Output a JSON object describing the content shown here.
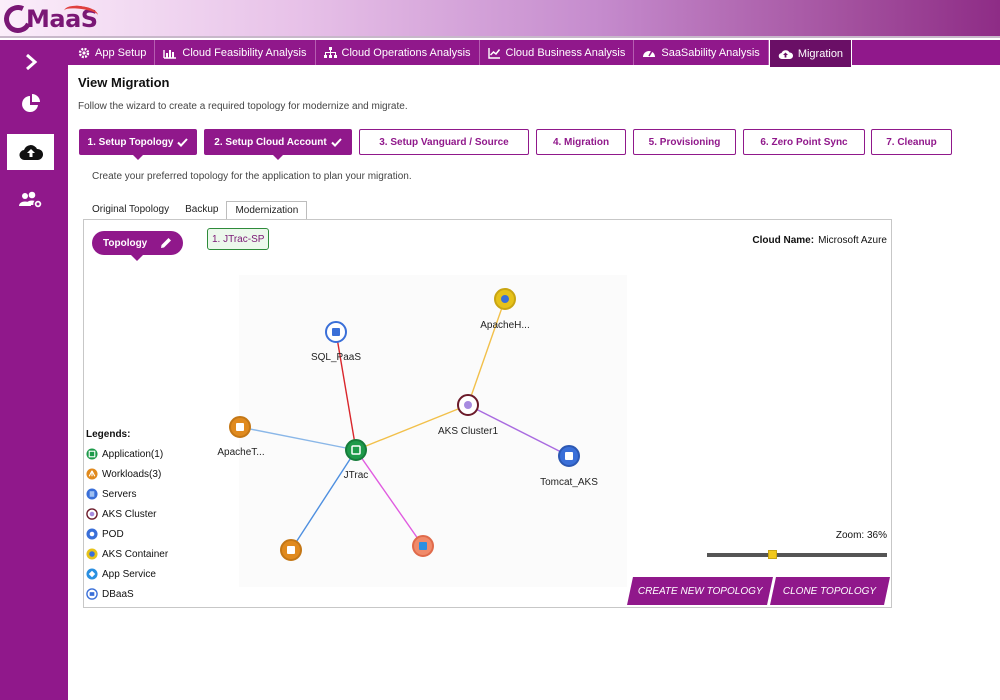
{
  "header": {
    "logo_text": "MaaS"
  },
  "sidebar": {
    "items": [
      {
        "name": "expand",
        "icon": "chevron-right-icon"
      },
      {
        "name": "dashboard",
        "icon": "pie-chart-icon"
      },
      {
        "name": "migration",
        "icon": "cloud-upload-icon"
      },
      {
        "name": "settings",
        "icon": "users-gear-icon"
      }
    ]
  },
  "tabs": [
    {
      "label": "App Setup",
      "icon": "gear-icon"
    },
    {
      "label": "Cloud Feasibility Analysis",
      "icon": "bar-chart-icon"
    },
    {
      "label": "Cloud Operations Analysis",
      "icon": "sitemap-icon"
    },
    {
      "label": "Cloud Business Analysis",
      "icon": "line-chart-icon"
    },
    {
      "label": "SaaSability Analysis",
      "icon": "gauge-icon"
    },
    {
      "label": "Migration",
      "icon": "cloud-upload-icon",
      "active": true
    }
  ],
  "page": {
    "title": "View Migration",
    "subtitle": "Follow the wizard to create a required topology for modernize and migrate.",
    "hint": "Create your preferred topology for the application to plan your migration."
  },
  "steps": [
    {
      "label": "1. Setup Topology",
      "done": true
    },
    {
      "label": "2. Setup Cloud Account",
      "done": true
    },
    {
      "label": "3. Setup Vanguard / Source",
      "done": false
    },
    {
      "label": "4. Migration",
      "done": false
    },
    {
      "label": "5. Provisioning",
      "done": false
    },
    {
      "label": "6. Zero Point Sync",
      "done": false
    },
    {
      "label": "7. Cleanup",
      "done": false
    }
  ],
  "subtabs": [
    {
      "label": "Original Topology"
    },
    {
      "label": "Backup"
    },
    {
      "label": "Modernization",
      "active": true
    }
  ],
  "panel": {
    "topology_button": "Topology",
    "chip": "1. JTrac-SP",
    "cloud_name_label": "Cloud Name:",
    "cloud_name_value": "Microsoft Azure",
    "zoom_label": "Zoom: 36%",
    "zoom_percent": 36,
    "create_button": "CREATE NEW TOPOLOGY",
    "clone_button": "CLONE TOPOLOGY"
  },
  "legend": {
    "title": "Legends:",
    "items": [
      {
        "label": "Application(1)",
        "color": "#1e9a4a"
      },
      {
        "label": "Workloads(3)",
        "color": "#e08a1e"
      },
      {
        "label": "Servers",
        "color": "#3a6fd8"
      },
      {
        "label": "AKS Cluster",
        "color": "#6b1a2a"
      },
      {
        "label": "POD",
        "color": "#3a6fd8"
      },
      {
        "label": "AKS Container",
        "color": "#e6c21a"
      },
      {
        "label": "App Service",
        "color": "#2b8fe0"
      },
      {
        "label": "DBaaS",
        "color": "#3a6fd8"
      }
    ]
  },
  "topology": {
    "nodes": [
      {
        "id": "sql",
        "label": "SQL_PaaS",
        "type": "dbaas"
      },
      {
        "id": "apacheh",
        "label": "ApacheH...",
        "type": "aks-container"
      },
      {
        "id": "aks",
        "label": "AKS Cluster1",
        "type": "aks-cluster"
      },
      {
        "id": "apachet",
        "label": "ApacheT...",
        "type": "workload"
      },
      {
        "id": "jtrac",
        "label": "JTrac",
        "type": "application"
      },
      {
        "id": "tomcat",
        "label": "Tomcat_AKS",
        "type": "pod"
      },
      {
        "id": "workload2",
        "label": "",
        "type": "workload"
      },
      {
        "id": "appservice",
        "label": "",
        "type": "app-service"
      }
    ],
    "edges": [
      {
        "from": "jtrac",
        "to": "sql",
        "color": "#d9262b"
      },
      {
        "from": "jtrac",
        "to": "apachet",
        "color": "#8ab7e8"
      },
      {
        "from": "jtrac",
        "to": "aks",
        "color": "#f2c04a"
      },
      {
        "from": "aks",
        "to": "apacheh",
        "color": "#f2c04a"
      },
      {
        "from": "aks",
        "to": "tomcat",
        "color": "#a96be0"
      },
      {
        "from": "jtrac",
        "to": "workload2",
        "color": "#4e8fe0"
      },
      {
        "from": "jtrac",
        "to": "appservice",
        "color": "#e05be0"
      }
    ]
  }
}
